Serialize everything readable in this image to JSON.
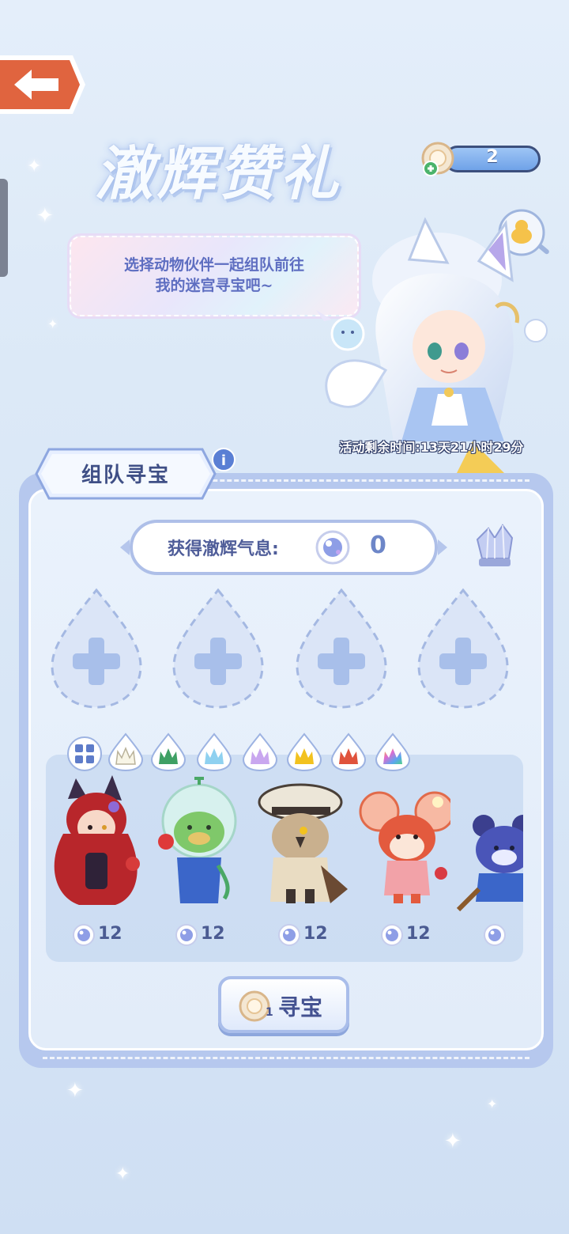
{
  "header": {
    "back_label": "",
    "title": "澈辉赞礼",
    "currency": {
      "value": "2"
    }
  },
  "speech_bubble": {
    "text": "选择动物伙伴一起组队前往\n我的迷宫寻宝吧~"
  },
  "event": {
    "timer_text": "活动剩余时间:13天21小时29分"
  },
  "panel": {
    "tab_label": "组队寻宝",
    "info_icon": "i",
    "reward": {
      "label": "获得澈辉气息:",
      "value": "0"
    }
  },
  "team_slots": [
    "add-slot-1",
    "add-slot-2",
    "add-slot-3",
    "add-slot-4"
  ],
  "filters": [
    {
      "name": "all",
      "color": "#5e7cc9"
    },
    {
      "name": "white",
      "color": "#f8f5e6"
    },
    {
      "name": "green",
      "color": "#3fa064"
    },
    {
      "name": "blue",
      "color": "#8fd1f0"
    },
    {
      "name": "purple",
      "color": "#c9a7ef"
    },
    {
      "name": "gold",
      "color": "#f2c21f"
    },
    {
      "name": "red",
      "color": "#e0533c"
    },
    {
      "name": "rainbow",
      "color": "#e06bd0"
    }
  ],
  "cards": [
    {
      "name": "red-cat-girl",
      "cost": "12"
    },
    {
      "name": "fishbowl-duck",
      "cost": "12"
    },
    {
      "name": "captain-owl",
      "cost": "12"
    },
    {
      "name": "strawberry-mouse",
      "cost": "12"
    },
    {
      "name": "blue-bear",
      "cost": ""
    }
  ],
  "search_button": {
    "label": "寻宝",
    "cost": "1"
  }
}
